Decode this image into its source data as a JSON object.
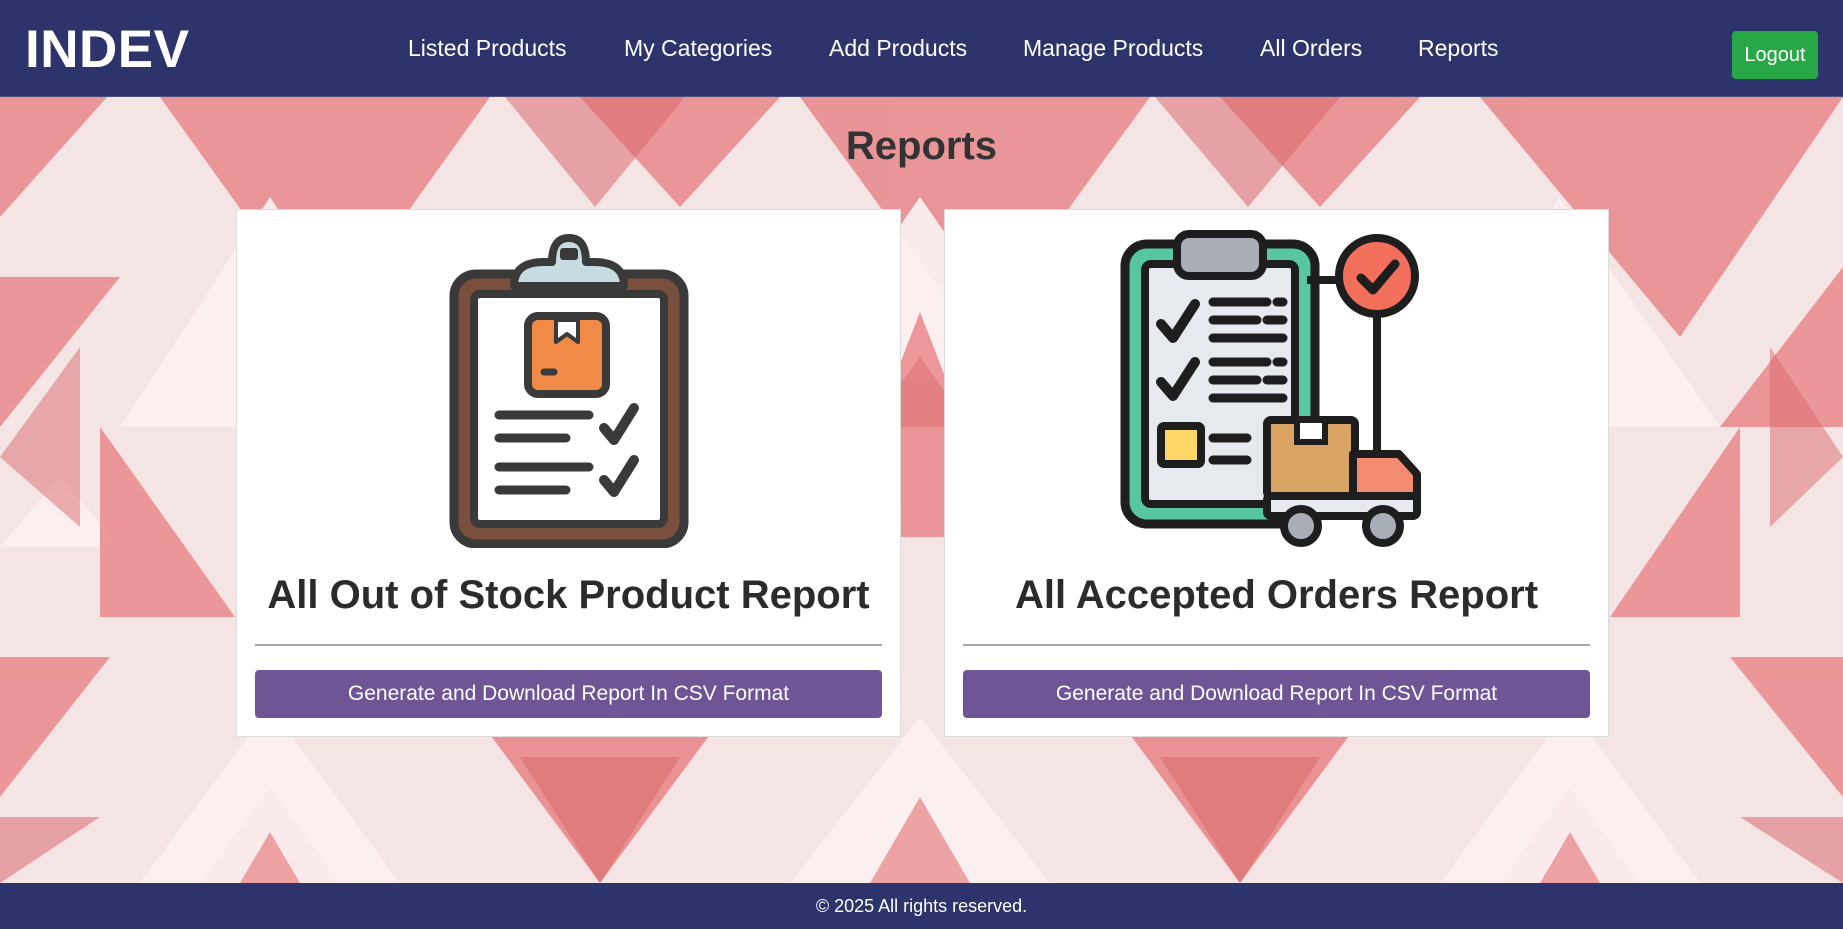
{
  "header": {
    "brand": "INDEV",
    "nav": [
      {
        "label": "Listed Products"
      },
      {
        "label": "My Categories"
      },
      {
        "label": "Add Products"
      },
      {
        "label": "Manage Products"
      },
      {
        "label": "All Orders"
      },
      {
        "label": "Reports"
      }
    ],
    "logout_label": "Logout"
  },
  "main": {
    "title": "Reports",
    "cards": [
      {
        "icon": "clipboard-checklist-icon",
        "title": "All Out of Stock Product Report",
        "button_label": "Generate and Download Report In CSV Format"
      },
      {
        "icon": "delivery-checklist-icon",
        "title": "All Accepted Orders Report",
        "button_label": "Generate and Download Report In CSV Format"
      }
    ]
  },
  "footer": {
    "text": "© 2025 All rights reserved."
  },
  "colors": {
    "navbar": "#2d336b",
    "logout": "#27a745",
    "card_button": "#6f5596",
    "background_accent": "#e57373"
  }
}
